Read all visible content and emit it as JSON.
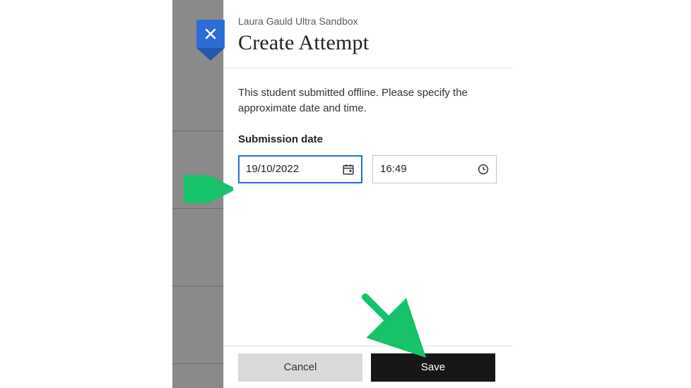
{
  "header": {
    "breadcrumb": "Laura Gauld Ultra Sandbox",
    "title": "Create Attempt"
  },
  "body": {
    "description": "This student submitted offline. Please specify the approximate date and time.",
    "date_label": "Submission date",
    "date_value": "19/10/2022",
    "time_value": "16:49"
  },
  "footer": {
    "cancel": "Cancel",
    "save": "Save"
  },
  "icons": {
    "close": "close-icon",
    "calendar": "calendar-icon",
    "clock": "clock-icon"
  }
}
